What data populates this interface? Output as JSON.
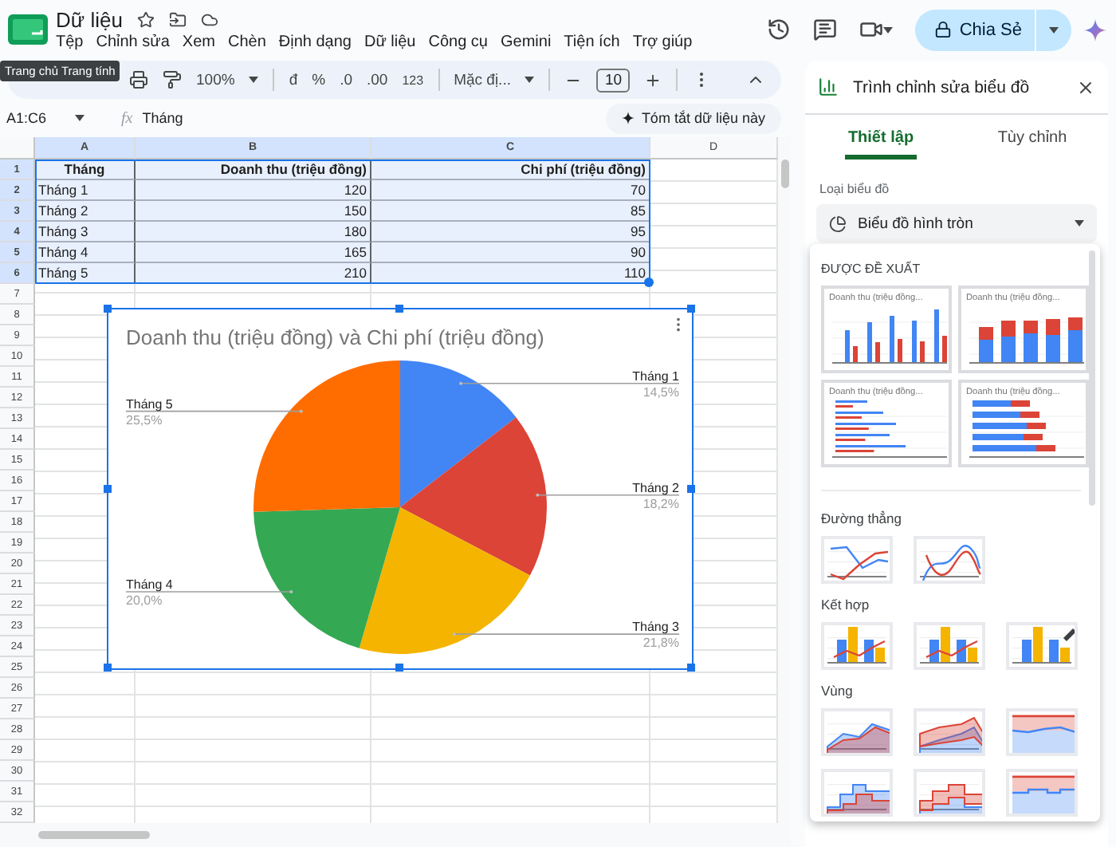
{
  "app": {
    "title": "Dữ liệu",
    "tooltip": "Trang chủ Trang tính",
    "share_label": "Chia Sẻ",
    "menu": [
      "Tệp",
      "Chỉnh sửa",
      "Xem",
      "Chèn",
      "Định dạng",
      "Dữ liệu",
      "Công cụ",
      "Gemini",
      "Tiện ích",
      "Trợ giúp"
    ]
  },
  "toolbar": {
    "zoom": "100%",
    "currency": "đ",
    "percent": "%",
    "decimal_decrease": ".0",
    "decimal_increase": ".00",
    "number_format": "123",
    "font": "Mặc đị...",
    "font_size": "10"
  },
  "formula_bar": {
    "cell_range": "A1:C6",
    "function_label": "fx",
    "value": "Tháng",
    "summarize_button": "Tóm tắt dữ liệu này"
  },
  "sheet": {
    "columns": [
      {
        "label": "A",
        "selected": true
      },
      {
        "label": "B",
        "selected": true
      },
      {
        "label": "C",
        "selected": true
      },
      {
        "label": "D",
        "selected": false
      }
    ],
    "rows": [
      {
        "number": "1",
        "selected": true,
        "kind": "header",
        "cells": [
          "Tháng",
          "Doanh thu (triệu đồng)",
          "Chi phí (triệu đồng)"
        ]
      },
      {
        "number": "2",
        "selected": true,
        "kind": "data",
        "cells": [
          "Tháng 1",
          "120",
          "70"
        ]
      },
      {
        "number": "3",
        "selected": true,
        "kind": "data",
        "cells": [
          "Tháng 2",
          "150",
          "85"
        ]
      },
      {
        "number": "4",
        "selected": true,
        "kind": "data",
        "cells": [
          "Tháng 3",
          "180",
          "95"
        ]
      },
      {
        "number": "5",
        "selected": true,
        "kind": "data",
        "cells": [
          "Tháng 4",
          "165",
          "90"
        ]
      },
      {
        "number": "6",
        "selected": true,
        "kind": "data",
        "cells": [
          "Tháng 5",
          "210",
          "110"
        ]
      },
      {
        "number": "7",
        "selected": false,
        "kind": "empty"
      },
      {
        "number": "8",
        "selected": false,
        "kind": "empty"
      },
      {
        "number": "9",
        "selected": false,
        "kind": "empty"
      },
      {
        "number": "10",
        "selected": false,
        "kind": "empty"
      },
      {
        "number": "11",
        "selected": false,
        "kind": "empty"
      },
      {
        "number": "12",
        "selected": false,
        "kind": "empty"
      },
      {
        "number": "13",
        "selected": false,
        "kind": "empty"
      },
      {
        "number": "14",
        "selected": false,
        "kind": "empty"
      },
      {
        "number": "15",
        "selected": false,
        "kind": "empty"
      },
      {
        "number": "16",
        "selected": false,
        "kind": "empty"
      },
      {
        "number": "17",
        "selected": false,
        "kind": "empty"
      },
      {
        "number": "18",
        "selected": false,
        "kind": "empty"
      },
      {
        "number": "19",
        "selected": false,
        "kind": "empty"
      },
      {
        "number": "20",
        "selected": false,
        "kind": "empty"
      },
      {
        "number": "21",
        "selected": false,
        "kind": "empty"
      },
      {
        "number": "22",
        "selected": false,
        "kind": "empty"
      },
      {
        "number": "23",
        "selected": false,
        "kind": "empty"
      },
      {
        "number": "24",
        "selected": false,
        "kind": "empty"
      },
      {
        "number": "25",
        "selected": false,
        "kind": "empty"
      },
      {
        "number": "26",
        "selected": false,
        "kind": "empty"
      },
      {
        "number": "27",
        "selected": false,
        "kind": "empty"
      },
      {
        "number": "28",
        "selected": false,
        "kind": "empty"
      },
      {
        "number": "29",
        "selected": false,
        "kind": "empty"
      },
      {
        "number": "30",
        "selected": false,
        "kind": "empty"
      },
      {
        "number": "31",
        "selected": false,
        "kind": "empty"
      },
      {
        "number": "32",
        "selected": false,
        "kind": "empty"
      }
    ]
  },
  "chart": {
    "chart_data": {
      "type": "pie",
      "title": "Doanh thu (triệu đồng) và Chi phí (triệu đồng)",
      "categories": [
        "Tháng 1",
        "Tháng 2",
        "Tháng 3",
        "Tháng 4",
        "Tháng 5"
      ],
      "series": [
        {
          "values": [
            14.5,
            18.2,
            21.8,
            20.0,
            25.5
          ]
        }
      ],
      "value_labels": [
        "14,5%",
        "18,2%",
        "21,8%",
        "20,0%",
        "25,5%"
      ]
    }
  },
  "chart_editor": {
    "title": "Trình chỉnh sửa biểu đồ",
    "tabs": [
      {
        "label": "Thiết lập",
        "selected": true
      },
      {
        "label": "Tùy chỉnh",
        "selected": false
      }
    ],
    "chart_type_label": "Loại biểu đồ",
    "chart_type": "Biểu đồ hình tròn",
    "sections": [
      {
        "heading": "ĐƯỢC ĐỀ XUẤT",
        "kind": "suggested",
        "items": [
          {
            "kind": "column",
            "caption": "Doanh thu (triệu đồng..."
          },
          {
            "kind": "stacked-column",
            "caption": "Doanh thu (triệu đồng..."
          },
          {
            "kind": "bar",
            "caption": "Doanh thu (triệu đồng..."
          },
          {
            "kind": "stacked-bar",
            "caption": "Doanh thu (triệu đồng..."
          }
        ]
      },
      {
        "heading": "Đường thẳng",
        "kind": "small",
        "items": [
          {
            "kind": "line"
          },
          {
            "kind": "smooth-line"
          }
        ]
      },
      {
        "heading": "Kết hợp",
        "kind": "small",
        "items": [
          {
            "kind": "combo"
          },
          {
            "kind": "combo"
          },
          {
            "kind": "combo-edit"
          }
        ]
      },
      {
        "heading": "Vùng",
        "kind": "small",
        "items": [
          {
            "kind": "area"
          },
          {
            "kind": "stacked-area"
          },
          {
            "kind": "percent-area"
          },
          {
            "kind": "stepped-area"
          },
          {
            "kind": "stacked-stepped-area"
          },
          {
            "kind": "percent-stepped-area"
          }
        ]
      }
    ]
  }
}
